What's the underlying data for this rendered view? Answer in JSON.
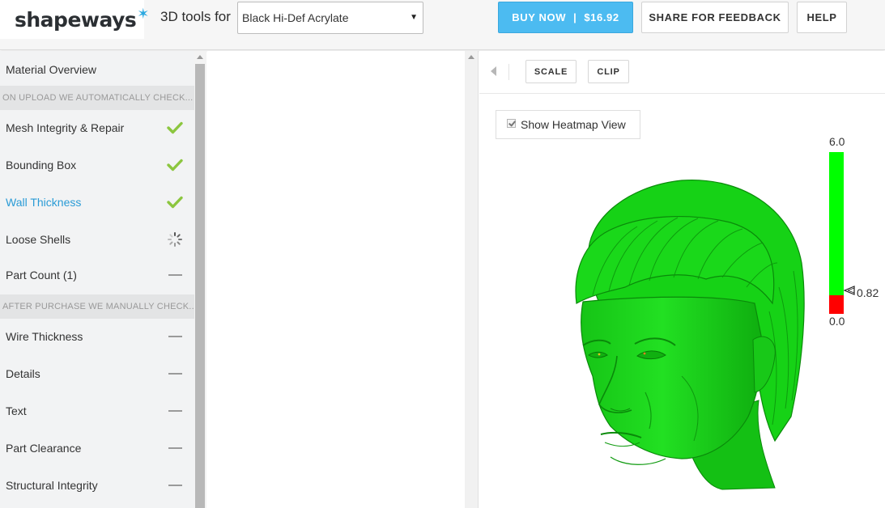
{
  "header": {
    "logo_text": "shapeways",
    "tools_label": "3D tools for",
    "material_selected": "Black Hi-Def Acrylate",
    "buy_label": "BUY NOW",
    "buy_price": "$16.92",
    "share_label": "SHARE FOR FEEDBACK",
    "help_label": "HELP"
  },
  "sidebar": {
    "overview": "Material Overview",
    "section_auto": "ON UPLOAD WE AUTOMATICALLY CHECK...",
    "auto_items": [
      {
        "label": "Mesh Integrity & Repair",
        "status": "pass"
      },
      {
        "label": "Bounding Box",
        "status": "pass"
      },
      {
        "label": "Wall Thickness",
        "status": "pass",
        "active": true
      },
      {
        "label": "Loose Shells",
        "status": "loading"
      },
      {
        "label": "Part Count (1)",
        "status": "none"
      }
    ],
    "section_manual": "AFTER PURCHASE WE MANUALLY CHECK...",
    "manual_items": [
      {
        "label": "Wire Thickness",
        "status": "none"
      },
      {
        "label": "Details",
        "status": "none"
      },
      {
        "label": "Text",
        "status": "none"
      },
      {
        "label": "Part Clearance",
        "status": "none"
      },
      {
        "label": "Structural Integrity",
        "status": "none"
      }
    ]
  },
  "viewer": {
    "scale_label": "SCALE",
    "clip_label": "CLIP",
    "heatmap_label": "Show Heatmap View",
    "heatmap_checked": true,
    "legend_max": "6.0",
    "legend_min": "0.0",
    "legend_marker": "0.82",
    "marker_value": 0.82,
    "range": [
      0,
      6
    ],
    "colors": {
      "pass": "#00ff00",
      "fail": "#ff0000",
      "check": "#8cc63f",
      "accent": "#4cbbf1",
      "link": "#2a9bd6"
    }
  }
}
